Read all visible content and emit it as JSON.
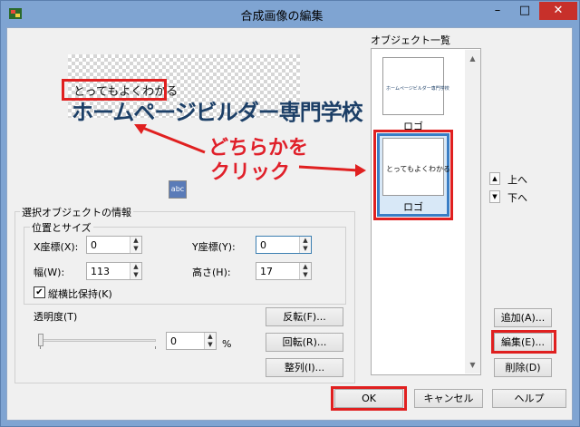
{
  "window": {
    "title": "合成画像の編集",
    "minimize": "–",
    "maximize": "□",
    "close": "✕"
  },
  "preview": {
    "small_text": "とってもよくわかる",
    "big_text": "ホームページビルダー専門学校",
    "annotation_line1": "どちらかを",
    "annotation_line2": "クリック"
  },
  "selected_info": {
    "group_label": "選択オブジェクトの情報",
    "position_group_label": "位置とサイズ",
    "x_label": "X座標(X):",
    "x_value": "0",
    "y_label": "Y座標(Y):",
    "y_value": "0",
    "width_label": "幅(W):",
    "width_value": "113",
    "height_label": "高さ(H):",
    "height_value": "17",
    "aspect_label": "縦横比保持(K)",
    "aspect_checked": "✔"
  },
  "transparency": {
    "label": "透明度(T)",
    "value": "0",
    "unit": "%",
    "level": 0
  },
  "buttons": {
    "flip": "反転(F)...",
    "rotate": "回転(R)...",
    "align": "整列(I)...",
    "add": "追加(A)...",
    "edit": "編集(E)...",
    "delete": "削除(D)",
    "ok": "OK",
    "cancel": "キャンセル",
    "help": "ヘルプ",
    "up": "上へ",
    "down": "下へ",
    "abc": "abc"
  },
  "object_list": {
    "label": "オブジェクト一覧",
    "items": [
      {
        "thumb_text": "ホームページビルダー専門学校",
        "name": "ロゴ"
      },
      {
        "thumb_text": "とってもよくわかる",
        "name": "ロゴ"
      }
    ]
  },
  "colors": {
    "titlebar": "#7fa4d2",
    "accent_red": "#e02020",
    "selection_blue": "#3a7ec5"
  }
}
